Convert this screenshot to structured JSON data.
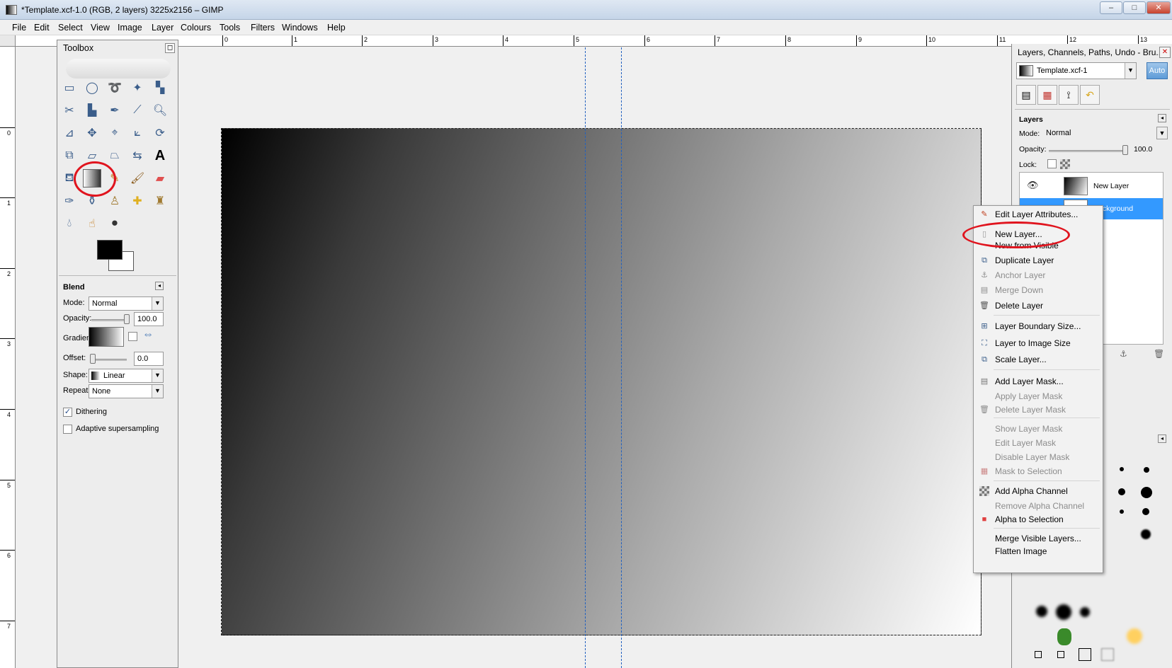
{
  "window": {
    "title": "*Template.xcf-1.0 (RGB, 2 layers) 3225x2156 – GIMP"
  },
  "menubar": [
    "File",
    "Edit",
    "Select",
    "View",
    "Image",
    "Layer",
    "Colours",
    "Tools",
    "Filters",
    "Windows",
    "Help"
  ],
  "ruler": {
    "h_labels": [
      "0",
      "1",
      "2",
      "3",
      "4",
      "5",
      "6",
      "7",
      "8",
      "9",
      "10",
      "11",
      "12",
      "13"
    ],
    "v_labels": [
      "0",
      "1",
      "2",
      "3",
      "4",
      "5",
      "6",
      "7"
    ]
  },
  "toolbox": {
    "title": "Toolbox",
    "options_title": "Blend",
    "mode_label": "Mode:",
    "mode_value": "Normal",
    "opacity_label": "Opacity:",
    "opacity_value": "100.0",
    "gradient_label": "Gradient:",
    "offset_label": "Offset:",
    "offset_value": "0.0",
    "shape_label": "Shape:",
    "shape_value": "Linear",
    "repeat_label": "Repeat:",
    "repeat_value": "None",
    "dithering_label": "Dithering",
    "dithering_checked": true,
    "adaptive_label": "Adaptive supersampling",
    "adaptive_checked": false
  },
  "dock": {
    "title": "Layers, Channels, Paths, Undo - Bru...",
    "image_combo": "Template.xcf-1",
    "auto_label": "Auto",
    "layers_label": "Layers",
    "mode_label": "Mode:",
    "mode_value": "Normal",
    "opacity_label": "Opacity:",
    "opacity_value": "100.0",
    "lock_label": "Lock:",
    "layers": [
      {
        "name": "New Layer",
        "selected": false
      },
      {
        "name": "Background",
        "selected": true
      }
    ]
  },
  "context_menu": {
    "items": [
      {
        "label": "Edit Layer Attributes...",
        "enabled": true
      },
      {
        "label": "New Layer...",
        "enabled": true
      },
      {
        "label": "New from Visible",
        "enabled": true
      },
      {
        "label": "Duplicate Layer",
        "enabled": true
      },
      {
        "label": "Anchor Layer",
        "enabled": false
      },
      {
        "label": "Merge Down",
        "enabled": false
      },
      {
        "label": "Delete Layer",
        "enabled": true
      },
      {
        "label": "Layer Boundary Size...",
        "enabled": true
      },
      {
        "label": "Layer to Image Size",
        "enabled": true
      },
      {
        "label": "Scale Layer...",
        "enabled": true
      },
      {
        "label": "Add Layer Mask...",
        "enabled": true
      },
      {
        "label": "Apply Layer Mask",
        "enabled": false
      },
      {
        "label": "Delete Layer Mask",
        "enabled": false
      },
      {
        "label": "Show Layer Mask",
        "enabled": false
      },
      {
        "label": "Edit Layer Mask",
        "enabled": false
      },
      {
        "label": "Disable Layer Mask",
        "enabled": false
      },
      {
        "label": "Mask to Selection",
        "enabled": false
      },
      {
        "label": "Add Alpha Channel",
        "enabled": true
      },
      {
        "label": "Remove Alpha Channel",
        "enabled": false
      },
      {
        "label": "Alpha to Selection",
        "enabled": true
      },
      {
        "label": "Merge Visible Layers...",
        "enabled": true
      },
      {
        "label": "Flatten Image",
        "enabled": true
      }
    ]
  },
  "colors": {
    "annotation": "#e0141e",
    "guide": "#2060c0",
    "selected_row": "#3399ff"
  }
}
